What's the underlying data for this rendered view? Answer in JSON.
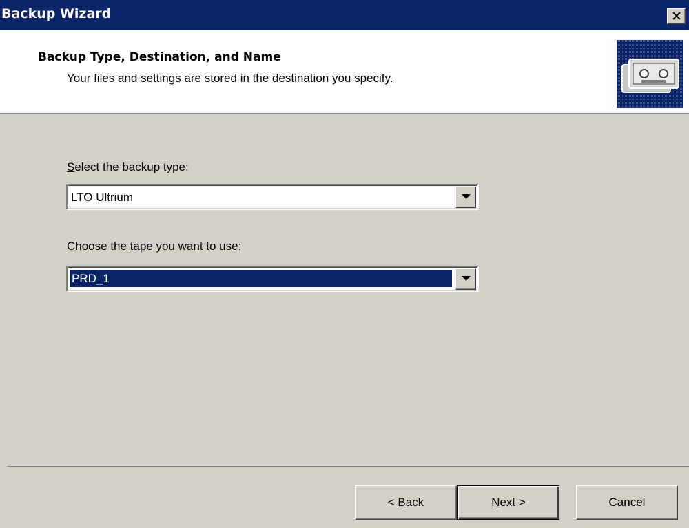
{
  "window": {
    "title": "Backup Wizard",
    "close_icon": "close-icon"
  },
  "header": {
    "title": "Backup Type, Destination, and Name",
    "subtitle": "Your files and settings are stored in the destination you specify.",
    "icon": "backup-tape-icon"
  },
  "form": {
    "backup_type": {
      "label_mnemonic": "S",
      "label_rest": "elect the backup type:",
      "value": "LTO Ultrium"
    },
    "tape": {
      "label_before": "Choose the ",
      "label_mnemonic": "t",
      "label_after": "ape you want to use:",
      "value": "PRD_1"
    }
  },
  "buttons": {
    "back": {
      "prefix": "< ",
      "mnemonic": "B",
      "rest": "ack"
    },
    "next": {
      "mnemonic": "N",
      "rest": "ext",
      "suffix": " >"
    },
    "cancel": {
      "label": "Cancel"
    }
  },
  "colors": {
    "titlebar": "#0a246a",
    "dialog_face": "#d4d0c8",
    "selection": "#0a246a"
  }
}
